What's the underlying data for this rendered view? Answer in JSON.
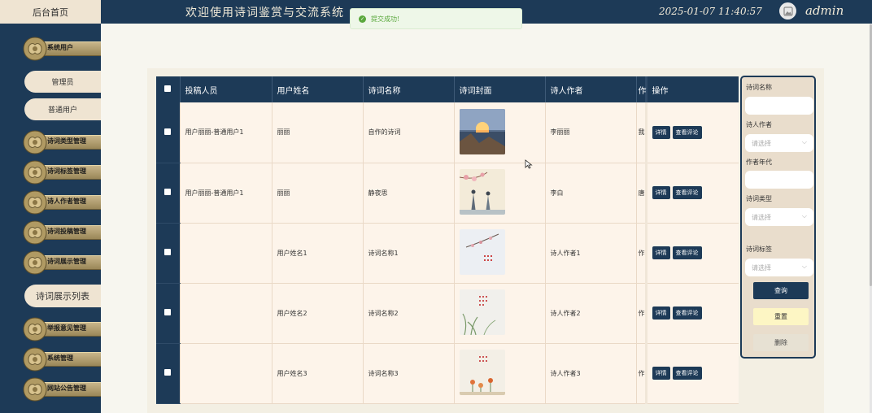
{
  "header": {
    "home_label": "后台首页",
    "title": "欢迎使用诗词鉴赏与交流系统",
    "datetime": "2025-01-07 11:40:57",
    "username": "admin",
    "avatar_icon": "image-icon"
  },
  "toast": {
    "message": "提交成功!",
    "icon": "check-circle-icon",
    "color": "#5aa83c"
  },
  "sidebar": {
    "items": [
      {
        "label": "系统用户"
      },
      {
        "label": "管理员"
      },
      {
        "label": "普通用户"
      },
      {
        "label": "诗词类型管理"
      },
      {
        "label": "诗词标签管理"
      },
      {
        "label": "诗人作者管理"
      },
      {
        "label": "诗词投稿管理"
      },
      {
        "label": "诗词展示管理"
      },
      {
        "label": "诗词展示列表"
      },
      {
        "label": "举报意见管理"
      },
      {
        "label": "系统管理"
      },
      {
        "label": "网站公告管理"
      }
    ]
  },
  "table": {
    "headers": [
      "投稿人员",
      "用户姓名",
      "诗词名称",
      "诗词封面",
      "诗人作者",
      "作",
      "操作"
    ],
    "detail_label": "详情",
    "comments_label": "查看评论",
    "rows": [
      {
        "submitter": "用户丽丽-普通用户1",
        "name": "丽丽",
        "poem": "自作的诗词",
        "author": "李丽丽",
        "extra": "我",
        "cover": "sunset"
      },
      {
        "submitter": "用户丽丽-普通用户1",
        "name": "丽丽",
        "poem": "静夜思",
        "author": "李白",
        "extra": "唐",
        "cover": "blossom"
      },
      {
        "submitter": "",
        "name": "用户姓名1",
        "poem": "诗词名称1",
        "author": "诗人作者1",
        "extra": "作",
        "cover": "branch"
      },
      {
        "submitter": "",
        "name": "用户姓名2",
        "poem": "诗词名称2",
        "author": "诗人作者2",
        "extra": "作",
        "cover": "grass"
      },
      {
        "submitter": "",
        "name": "用户姓名3",
        "poem": "诗词名称3",
        "author": "诗人作者3",
        "extra": "作",
        "cover": "flowers"
      }
    ]
  },
  "filter": {
    "poem_name_label": "诗词名称",
    "author_label": "诗人作者",
    "era_label": "作者年代",
    "type_label": "诗词类型",
    "tag_label": "诗词标签",
    "select_placeholder": "请选择",
    "query_label": "查询",
    "reset_label": "重置",
    "delete_label": "删除"
  },
  "colors": {
    "primary": "#1d3a57",
    "cream": "#efe4d2",
    "row_bg": "#fdf4ea"
  }
}
